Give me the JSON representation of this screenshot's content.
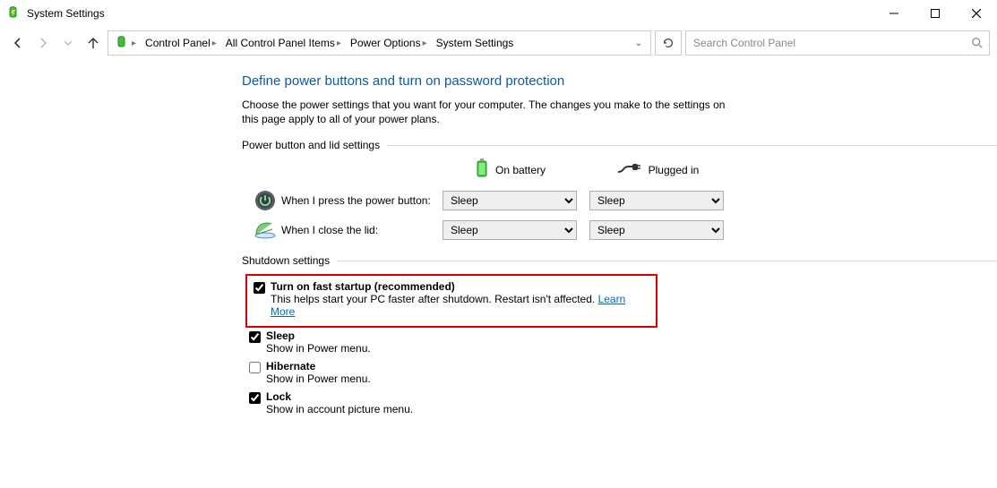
{
  "window": {
    "title": "System Settings"
  },
  "breadcrumb": {
    "items": [
      "Control Panel",
      "All Control Panel Items",
      "Power Options",
      "System Settings"
    ]
  },
  "search": {
    "placeholder": "Search Control Panel"
  },
  "page": {
    "heading": "Define power buttons and turn on password protection",
    "description": "Choose the power settings that you want for your computer. The changes you make to the settings on this page apply to all of your power plans."
  },
  "sections": {
    "power_button_lid": {
      "label": "Power button and lid settings",
      "battery_header": "On battery",
      "plugged_header": "Plugged in",
      "rows": [
        {
          "label": "When I press the power button:",
          "battery": "Sleep",
          "plugged": "Sleep"
        },
        {
          "label": "When I close the lid:",
          "battery": "Sleep",
          "plugged": "Sleep"
        }
      ]
    },
    "shutdown": {
      "label": "Shutdown settings",
      "items": [
        {
          "checked": true,
          "title": "Turn on fast startup (recommended)",
          "sub": "This helps start your PC faster after shutdown. Restart isn't affected. ",
          "link": "Learn More",
          "highlighted": true
        },
        {
          "checked": true,
          "title": "Sleep",
          "sub": "Show in Power menu."
        },
        {
          "checked": false,
          "title": "Hibernate",
          "sub": "Show in Power menu."
        },
        {
          "checked": true,
          "title": "Lock",
          "sub": "Show in account picture menu."
        }
      ]
    }
  },
  "select_options": [
    "Sleep"
  ]
}
